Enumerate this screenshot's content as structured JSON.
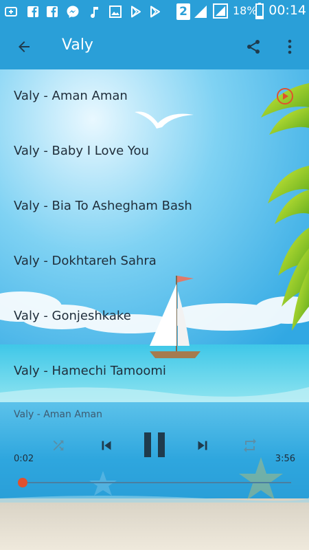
{
  "status_bar": {
    "battery_percent": "18%",
    "time": "00:14",
    "sim_number": "2"
  },
  "app_bar": {
    "title": "Valy"
  },
  "tracks": [
    {
      "title": "Valy - Aman Aman",
      "playing": true
    },
    {
      "title": "Valy - Baby I Love You",
      "playing": false
    },
    {
      "title": "Valy - Bia To Ashegham Bash",
      "playing": false
    },
    {
      "title": "Valy - Dokhtareh Sahra",
      "playing": false
    },
    {
      "title": "Valy - Gonjeshkake",
      "playing": false
    },
    {
      "title": "Valy - Hamechi Tamoomi",
      "playing": false
    }
  ],
  "player": {
    "now_playing": "Valy - Aman Aman",
    "current_time": "0:02",
    "total_time": "3:56",
    "progress_fraction": 0.008
  },
  "colors": {
    "primary": "#2a9fd8",
    "accent": "#e0512e",
    "text": "#1f2d3a"
  }
}
